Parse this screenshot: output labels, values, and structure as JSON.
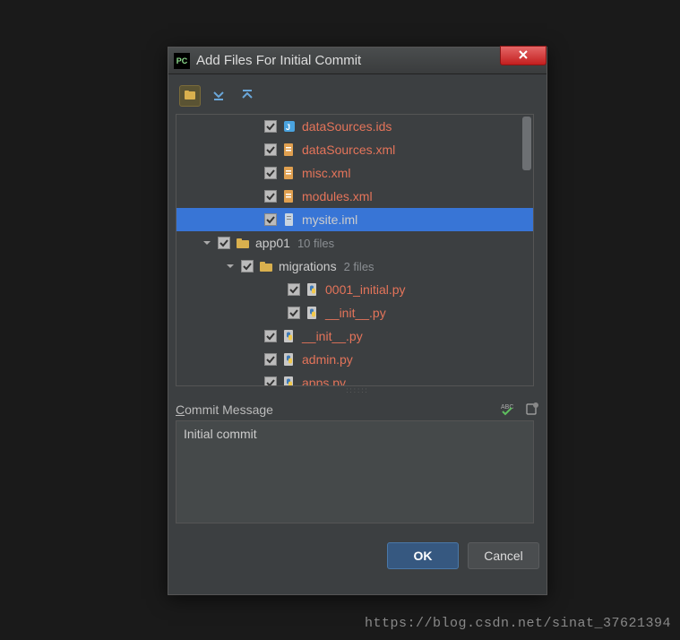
{
  "dialog": {
    "title": "Add Files For Initial Commit"
  },
  "toolbar": {
    "group_by_dir": "group-by-directory",
    "expand_all": "expand-all",
    "collapse_all": "collapse-all"
  },
  "tree": {
    "rows": [
      {
        "indent": 80,
        "arrow": "none",
        "checked": true,
        "icon": "ids",
        "name": "dataSources.ids",
        "color": "unv",
        "selected": false
      },
      {
        "indent": 80,
        "arrow": "none",
        "checked": true,
        "icon": "xml",
        "name": "dataSources.xml",
        "color": "unv",
        "selected": false
      },
      {
        "indent": 80,
        "arrow": "none",
        "checked": true,
        "icon": "xml",
        "name": "misc.xml",
        "color": "unv",
        "selected": false
      },
      {
        "indent": 80,
        "arrow": "none",
        "checked": true,
        "icon": "xml",
        "name": "modules.xml",
        "color": "unv",
        "selected": false
      },
      {
        "indent": 80,
        "arrow": "none",
        "checked": true,
        "icon": "file",
        "name": "mysite.iml",
        "color": "norm",
        "selected": true
      },
      {
        "indent": 28,
        "arrow": "down",
        "checked": true,
        "icon": "folder",
        "name": "app01",
        "color": "norm",
        "selected": false,
        "meta": "10 files"
      },
      {
        "indent": 54,
        "arrow": "down",
        "checked": true,
        "icon": "folder",
        "name": "migrations",
        "color": "norm",
        "selected": false,
        "meta": "2 files"
      },
      {
        "indent": 106,
        "arrow": "none",
        "checked": true,
        "icon": "py",
        "name": "0001_initial.py",
        "color": "unv",
        "selected": false
      },
      {
        "indent": 106,
        "arrow": "none",
        "checked": true,
        "icon": "py",
        "name": "__init__.py",
        "color": "unv",
        "selected": false
      },
      {
        "indent": 80,
        "arrow": "none",
        "checked": true,
        "icon": "py",
        "name": "__init__.py",
        "color": "unv",
        "selected": false
      },
      {
        "indent": 80,
        "arrow": "none",
        "checked": true,
        "icon": "py",
        "name": "admin.py",
        "color": "unv",
        "selected": false
      },
      {
        "indent": 80,
        "arrow": "none",
        "checked": true,
        "icon": "py",
        "name": "apps.py",
        "color": "unv",
        "selected": false
      }
    ]
  },
  "commit": {
    "label_pre": "C",
    "label_rest": "ommit Message",
    "message": "Initial commit"
  },
  "buttons": {
    "ok": "OK",
    "cancel": "Cancel"
  },
  "watermark": "https://blog.csdn.net/sinat_37621394"
}
